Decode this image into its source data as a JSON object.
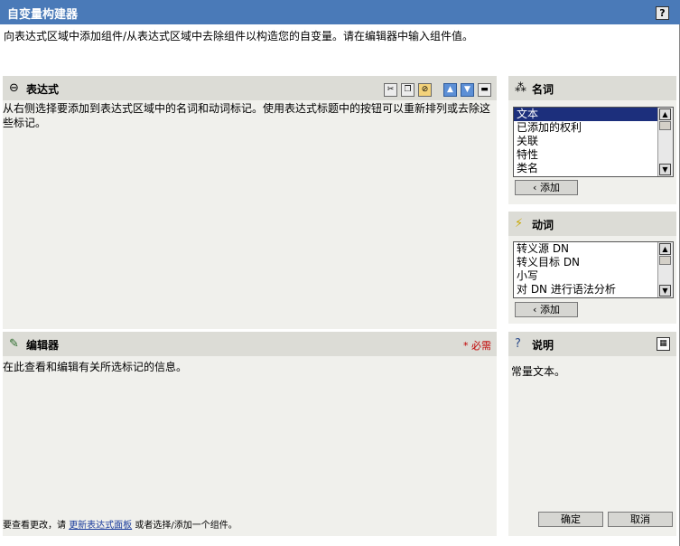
{
  "window": {
    "title": "自变量构建器",
    "help_label": "?"
  },
  "intro_text": "向表达式区域中添加组件/从表达式区域中去除组件以构造您的自变量。请在编辑器中输入组件值。",
  "expression": {
    "title": "表达式",
    "description": "从右侧选择要添加到表达式区域中的名词和动词标记。使用表达式标题中的按钮可以重新排列或去除这些标记。",
    "toolbar_icons": [
      "cut-icon",
      "copy-icon",
      "clear-icon",
      "move-up-icon",
      "move-down-icon",
      "collapse-icon"
    ]
  },
  "nouns": {
    "title": "名词",
    "items": [
      "文本",
      "已添加的权利",
      "关联",
      "特性",
      "类名",
      "…"
    ],
    "selected_index": 0,
    "add_label": "‹ 添加"
  },
  "verbs": {
    "title": "动词",
    "items": [
      "转义源 DN",
      "转义目标 DN",
      "小写",
      "对 DN 进行语法分析",
      "…"
    ],
    "add_label": "‹ 添加"
  },
  "editor": {
    "title": "编辑器",
    "required_label": "* 必需",
    "info": "在此查看和编辑有关所选标记的信息。",
    "footer_prefix": "要查看更改，请",
    "footer_link": "更新表达式面板",
    "footer_suffix": "或者选择/添加一个组件。"
  },
  "description": {
    "title": "说明",
    "text": "常量文本。",
    "ok_label": "确定",
    "cancel_label": "取消"
  }
}
